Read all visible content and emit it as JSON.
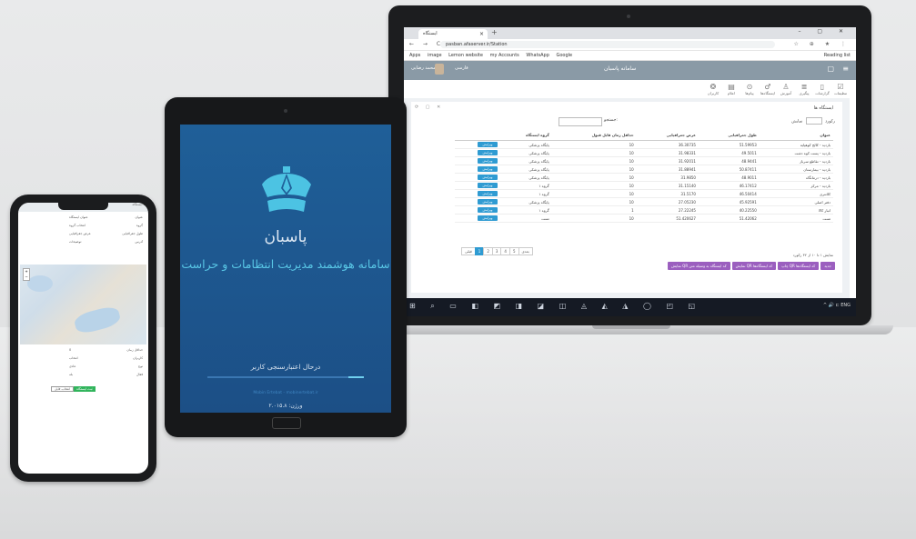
{
  "browser": {
    "tab_title": "ایستگاه",
    "new_tab": "+",
    "window_controls": "– ▢ ✕",
    "nav_buttons": "← → C",
    "url": "pasban.afaserver.ir/Station",
    "addr_icons": "☆ ⊕ ★ ⋮",
    "bookmarks": [
      "Apps",
      "image",
      "Lemon website",
      "my Accounts",
      "WhatsApp",
      "Google"
    ],
    "reading_list": "Reading list"
  },
  "app": {
    "title": "سامانه پاسبان",
    "user_name": "محمد رضایی",
    "dropdown": "فارسی",
    "toolbar": [
      "تنظیمات",
      "گزارشات",
      "پیگیری",
      "آموزش",
      "ایستگاه‌ها",
      "پیام‌ها",
      "اعلام",
      "کاربران"
    ],
    "panel_title": "ایستگاه ها",
    "panel_controls": "⟳ ▢ ✕",
    "show_label": "نمایش",
    "show_count": "10",
    "show_suffix": "رکورد",
    "search_label": "جستجو:",
    "table": {
      "headers": [
        "عنوان",
        "طول جغرافیایی",
        "عرض جغرافیایی",
        "حداقل زمان قابل قبول",
        "گروه ایستگاه",
        ""
      ],
      "rows": [
        [
          "بازدید - کالج کوهپایه",
          "51.59953",
          "36.30735",
          "10",
          "پایگاه پزشکی",
          "ویرایش"
        ],
        [
          "بازدید - پست کوه دشت",
          "49.5011",
          "31.98331",
          "10",
          "پایگاه پزشکی",
          "ویرایش"
        ],
        [
          "بازدید - تقاطع سرباز",
          "48.9441",
          "31.92011",
          "10",
          "پایگاه پزشکی",
          "ویرایش"
        ],
        [
          "بازدید - بیمارستان",
          "50.87411",
          "31.88941",
          "10",
          "پایگاه پزشکی",
          "ویرایش"
        ],
        [
          "بازدید - درمانگاه",
          "48.9011",
          "31.9850",
          "10",
          "پایگاه پزشکی",
          "ویرایش"
        ],
        [
          "بازدید - مرکز",
          "46.17412",
          "31.15140",
          "10",
          "گروه ۱",
          "ویرایش"
        ],
        [
          "کلانتری",
          "46.50414",
          "31.5170",
          "10",
          "گروه ۱",
          "ویرایش"
        ],
        [
          "دفتر اصلی",
          "45.92591",
          "27.05230",
          "10",
          "پایگاه پزشکی",
          "ویرایش"
        ],
        [
          "انبار کالا",
          "40.22550",
          "27.22245",
          "1",
          "گروه ۱",
          "ویرایش"
        ],
        [
          "تست",
          "51.42062",
          "51.420627",
          "10",
          "تست",
          "ویرایش"
        ]
      ]
    },
    "pager": [
      "قبلی",
      "1",
      "2",
      "3",
      "4",
      "5",
      "بعدی"
    ],
    "info": "نمایش ۱ تا ۱۰ از ۳۲ رکورد",
    "action_buttons": [
      "جدید",
      "چاپ QR کد ایستگاه‌ها",
      "نمایش QR کد ایستگاه‌ها",
      "نمایش QR کد ایستگاه به وسیله متن"
    ]
  },
  "taskbar": {
    "icons": "⊞ ⌕ ▭ ◧ ◩ ◨ ◪ ◫ ◬ ◭ ◮ ◯ ◰ ◱",
    "tray": "^ 🔊 ⊏ ENG"
  },
  "tablet": {
    "app_name": "پاسبان",
    "subtitle": "سامانه هوشمند مدیریت انتظامات و حراست",
    "status": "درحال اعتبارسنجی کاربر",
    "footer_link": "Mobin Ertebat - mobinertebat.ir",
    "version": "ورژن: ۲.۰۱۵.۸",
    "progress": 0.1
  },
  "phone": {
    "header": "ثبت ایستگاه",
    "form": [
      [
        "عنوان",
        "عنوان ایستگاه"
      ],
      [
        "گروه",
        "انتخاب گروه"
      ],
      [
        "طول جغرافیایی",
        "عرض جغرافیایی"
      ],
      [
        "آدرس",
        "توضیحات"
      ]
    ],
    "zoom": "+−",
    "lower": [
      [
        "حداقل زمان",
        "0"
      ],
      [
        "کاربران",
        "انتخاب"
      ],
      [
        "نوع",
        "عادی"
      ],
      [
        "فعال",
        "بله"
      ]
    ],
    "green_button": "ثبت ایستگاه",
    "file_button": "انتخاب فایل"
  },
  "colors": {
    "app_header": "#8a9aa6",
    "tablet_bg": "#1f5f98",
    "accent_cyan": "#59c7e6",
    "button_blue": "#2f9bd2",
    "button_purple": "#9b5fbf"
  }
}
